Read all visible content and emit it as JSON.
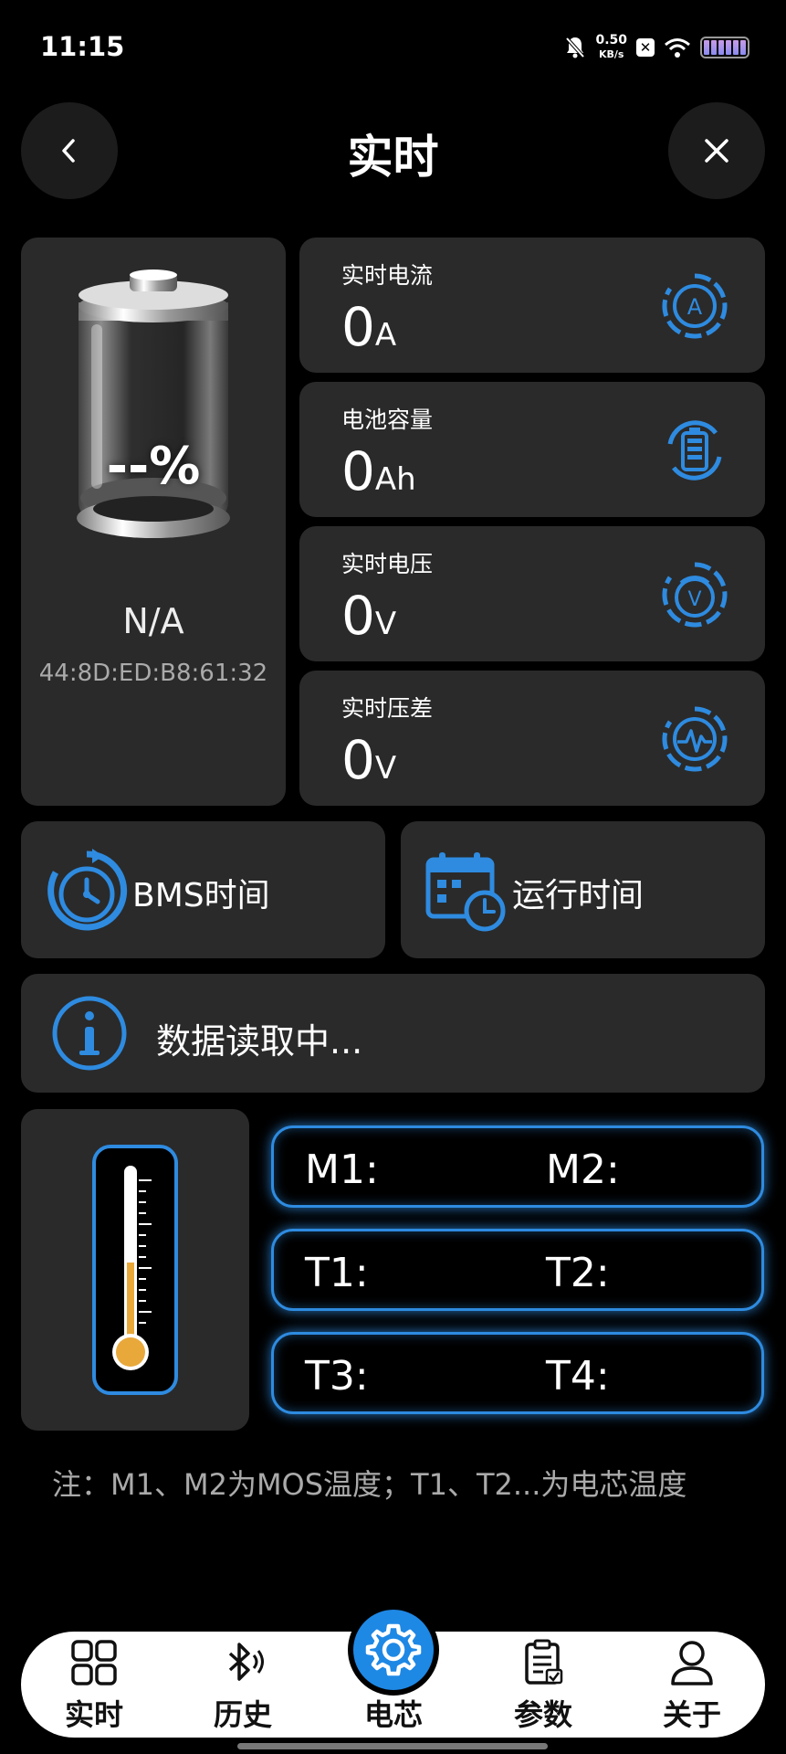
{
  "status_bar": {
    "time": "11:15",
    "speed_value": "0.50",
    "speed_unit": "KB/s"
  },
  "header": {
    "title": "实时"
  },
  "battery": {
    "percent": "--%",
    "name": "N/A",
    "mac": "44:8D:ED:B8:61:32"
  },
  "metrics": [
    {
      "label": "实时电流",
      "value": "0",
      "unit": "A",
      "icon": "ammeter-icon"
    },
    {
      "label": "电池容量",
      "value": "0",
      "unit": "Ah",
      "icon": "battery-capacity-icon"
    },
    {
      "label": "实时电压",
      "value": "0",
      "unit": "V",
      "icon": "voltmeter-icon"
    },
    {
      "label": "实时压差",
      "value": "0",
      "unit": "V",
      "icon": "pulse-icon"
    }
  ],
  "time_cards": {
    "bms_time_label": "BMS时间",
    "run_time_label": "运行时间"
  },
  "info": {
    "status_text": "数据读取中..."
  },
  "temperatures": {
    "m1": "M1:",
    "m2": "M2:",
    "t1": "T1:",
    "t2": "T2:",
    "t3": "T3:",
    "t4": "T4:"
  },
  "note": "注：M1、M2为MOS温度；T1、T2...为电芯温度",
  "bottom_nav": {
    "items": [
      {
        "label": "实时",
        "icon": "grid-icon"
      },
      {
        "label": "历史",
        "icon": "bluetooth-icon"
      },
      {
        "label": "电芯",
        "icon": "gear-icon"
      },
      {
        "label": "参数",
        "icon": "clipboard-icon"
      },
      {
        "label": "关于",
        "icon": "user-icon"
      }
    ]
  },
  "colors": {
    "accent": "#2e8be0",
    "card_bg": "#2a2a2a",
    "thermo_fill": "#e8a83a"
  }
}
